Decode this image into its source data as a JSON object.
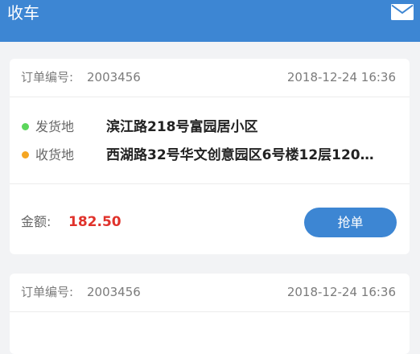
{
  "header": {
    "title": "收车",
    "mail_icon": "mail-icon"
  },
  "colors": {
    "brand": "#3d86d3",
    "amount": "#e0322b",
    "from_dot": "#5cd65c",
    "to_dot": "#f5a623"
  },
  "orders": [
    {
      "order_label": "订单编号:",
      "order_no": "2003456",
      "time": "2018-12-24  16:36",
      "from_label": "发货地",
      "from_address": "滨江路218号富园居小区",
      "to_label": "收货地",
      "to_address": "西湖路32号华文创意园区6号楼12层120…",
      "amount_label": "金额:",
      "amount": "182.50",
      "button_label": "抢单"
    },
    {
      "order_label": "订单编号:",
      "order_no": "2003456",
      "time": "2018-12-24  16:36"
    }
  ]
}
